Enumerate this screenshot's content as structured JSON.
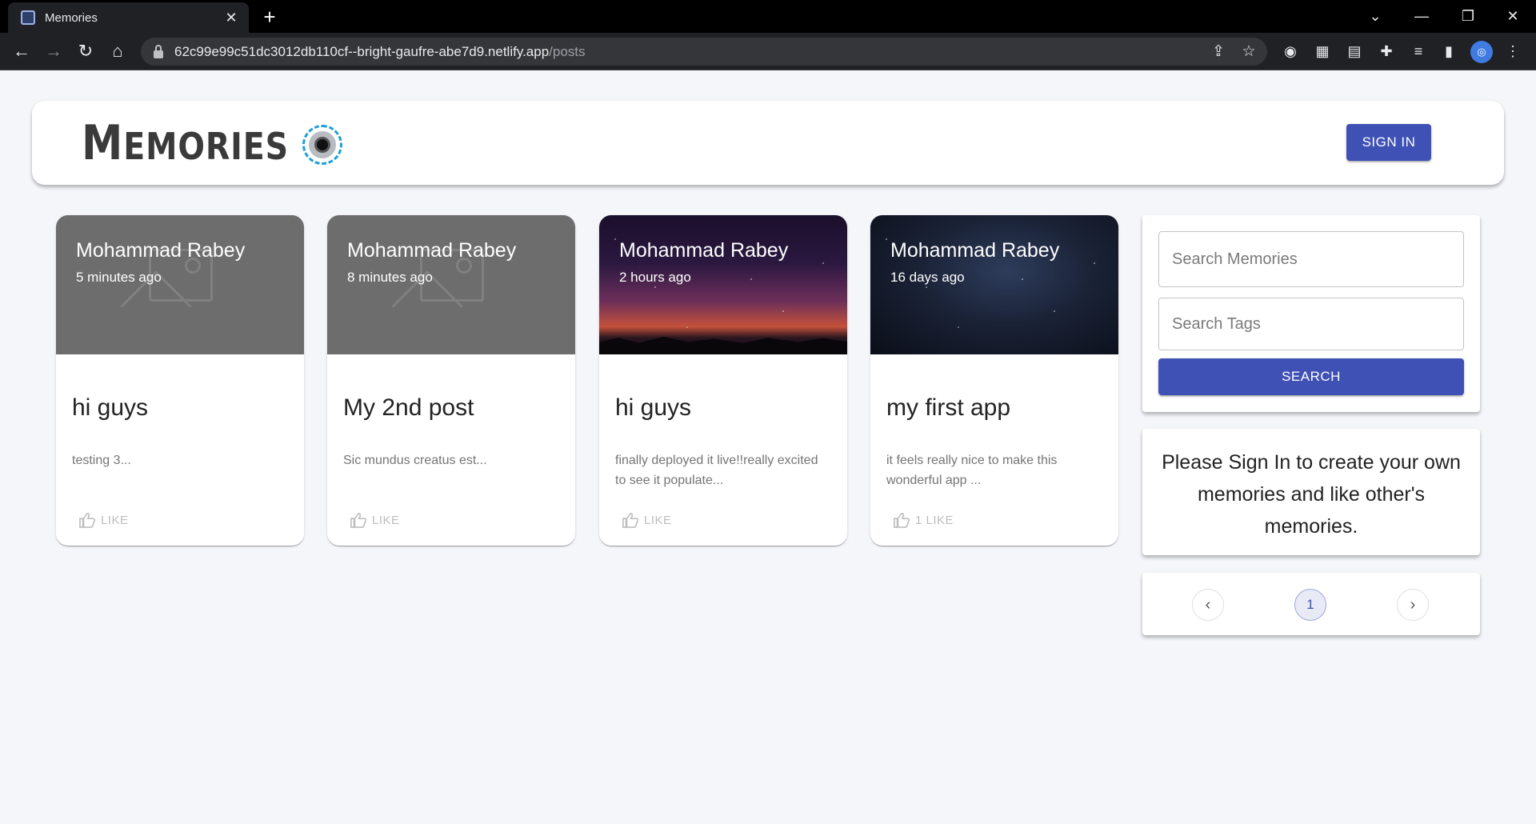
{
  "browser": {
    "tab_title": "Memories",
    "url_host": "62c99e99c51dc3012db110cf--bright-gaufre-abe7d9.netlify.app",
    "url_path": "/posts"
  },
  "header": {
    "brand_first": "M",
    "brand_rest": "EMORIES",
    "signin_label": "SIGN IN"
  },
  "posts": [
    {
      "author": "Mohammad Rabey",
      "time": "5 minutes ago",
      "title": "hi guys",
      "message": "testing 3...",
      "like_label": "LIKE",
      "media": "placeholder"
    },
    {
      "author": "Mohammad Rabey",
      "time": "8 minutes ago",
      "title": "My 2nd post",
      "message": "Sic mundus creatus est...",
      "like_label": "LIKE",
      "media": "placeholder"
    },
    {
      "author": "Mohammad Rabey",
      "time": "2 hours ago",
      "title": "hi guys",
      "message": "finally deployed it live!!really excited to see it populate...",
      "like_label": "LIKE",
      "media": "night-sky-sunset"
    },
    {
      "author": "Mohammad Rabey",
      "time": "16 days ago",
      "title": "my first app",
      "message": "it feels really nice to make this wonderful app ...",
      "like_label": "1 LIKE",
      "media": "starry-sky"
    }
  ],
  "search": {
    "memories_placeholder": "Search Memories",
    "tags_placeholder": "Search Tags",
    "button_label": "SEARCH"
  },
  "notice": {
    "text": "Please Sign In to create your own memories and like other's memories."
  },
  "pagination": {
    "current_page": "1"
  },
  "colors": {
    "primary": "#3f51b5",
    "background": "#f5f6fa",
    "logo_accent": "#1ea0d6"
  }
}
